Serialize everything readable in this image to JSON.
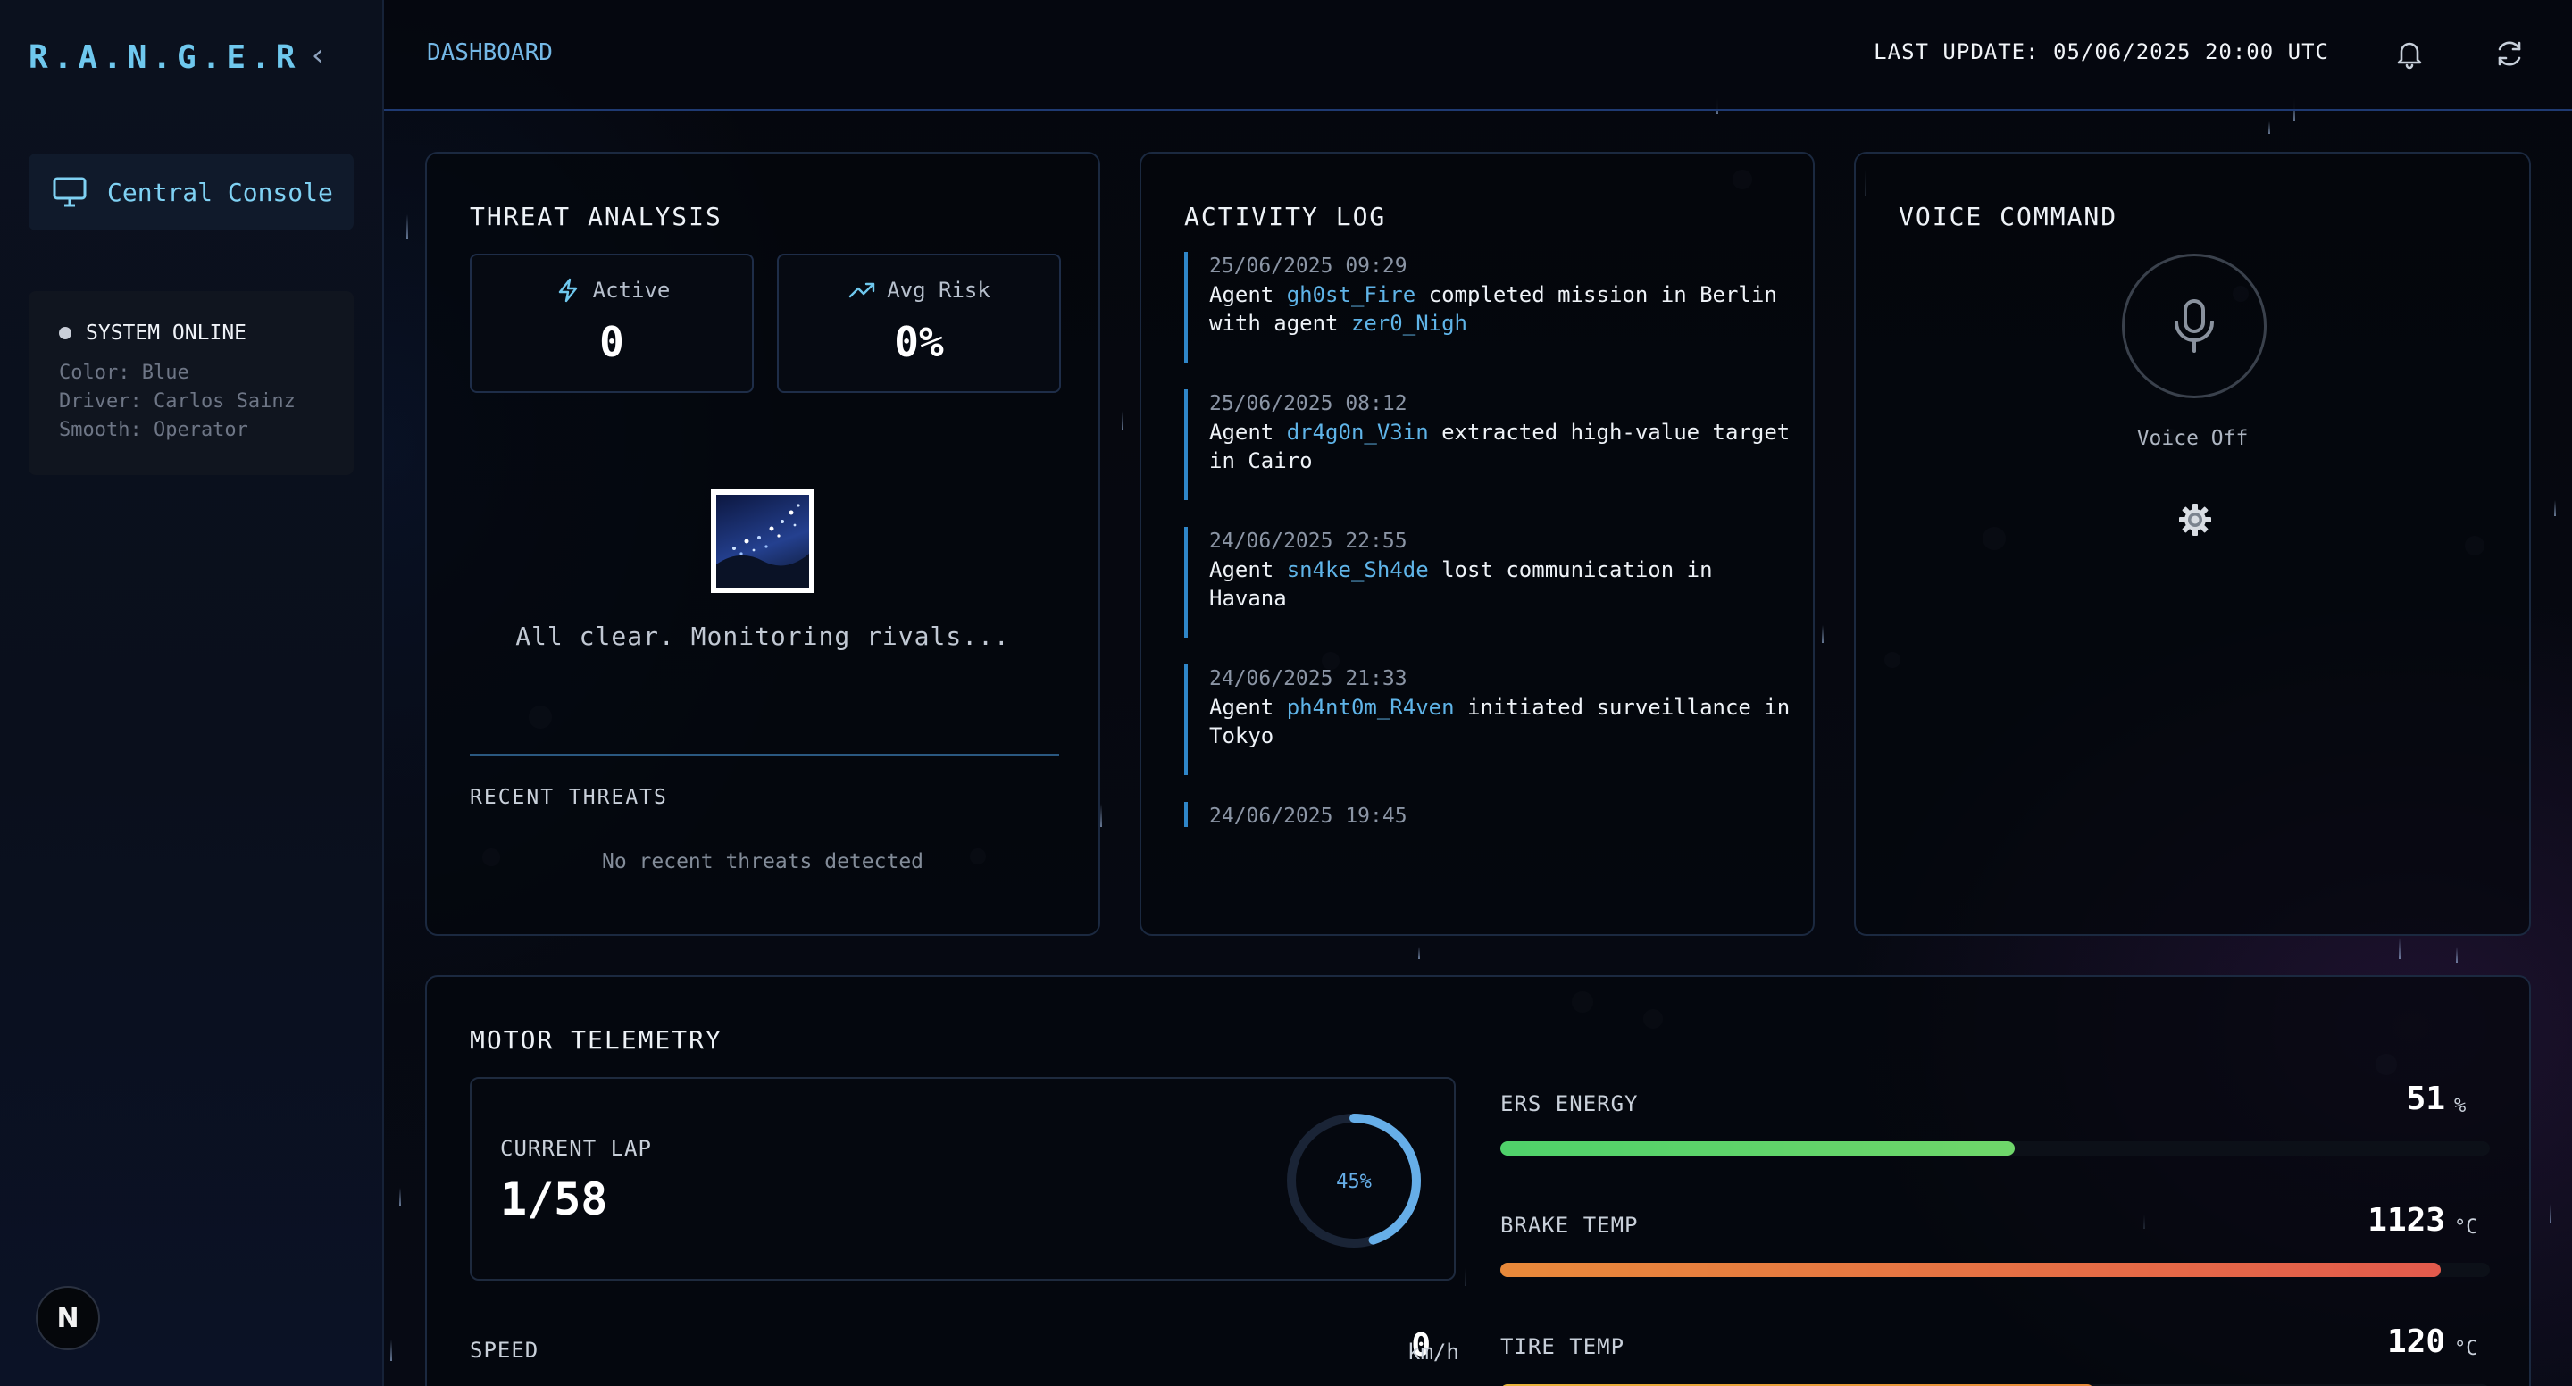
{
  "sidebar": {
    "brand": "R.A.N.G.E.R",
    "nav": [
      {
        "label": "Central Console",
        "icon": "monitor-icon"
      }
    ],
    "status": {
      "title": "SYSTEM ONLINE",
      "color": "Color: Blue",
      "driver": "Driver: Carlos Sainz",
      "smooth": "Smooth: Operator"
    },
    "badge": "N"
  },
  "header": {
    "breadcrumb": "DASHBOARD",
    "last_update": "LAST UPDATE: 05/06/2025 20:00 UTC"
  },
  "threat": {
    "title": "THREAT ANALYSIS",
    "active_label": "Active",
    "active_value": "0",
    "risk_label": "Avg Risk",
    "risk_value": "0%",
    "clear_text": "All clear. Monitoring rivals...",
    "recent_title": "RECENT THREATS",
    "recent_empty": "No recent threats detected"
  },
  "activity": {
    "title": "ACTIVITY LOG",
    "entries": [
      {
        "time": "25/06/2025 09:29",
        "pre": "Agent ",
        "agent": "gh0st_Fire",
        "mid": " completed mission in Berlin with agent ",
        "agent2": "zer0_Nigh",
        "post": ""
      },
      {
        "time": "25/06/2025 08:12",
        "pre": "Agent ",
        "agent": "dr4g0n_V3in",
        "mid": " extracted high-value target in Cairo",
        "agent2": "",
        "post": ""
      },
      {
        "time": "24/06/2025 22:55",
        "pre": "Agent ",
        "agent": "sn4ke_Sh4de",
        "mid": " lost communication in Havana",
        "agent2": "",
        "post": ""
      },
      {
        "time": "24/06/2025 21:33",
        "pre": "Agent ",
        "agent": "ph4nt0m_R4ven",
        "mid": " initiated surveillance in Tokyo",
        "agent2": "",
        "post": ""
      },
      {
        "time": "24/06/2025 19:45",
        "pre": "",
        "agent": "",
        "mid": "",
        "agent2": "",
        "post": ""
      }
    ]
  },
  "voice": {
    "title": "VOICE COMMAND",
    "status": "Voice Off"
  },
  "telemetry": {
    "title": "MOTOR TELEMETRY",
    "lap_label": "CURRENT LAP",
    "lap_value": "1/58",
    "progress_text": "45%",
    "progress": 0.45,
    "speed_label": "SPEED",
    "speed_value": "0",
    "speed_unit": "km/h",
    "metrics": [
      {
        "label": "ERS ENERGY",
        "value": "51",
        "unit": "%",
        "fill": 0.52,
        "color_from": "#4fd16a",
        "color_to": "#6fd66a"
      },
      {
        "label": "BRAKE TEMP",
        "value": "1123",
        "unit": "°C",
        "fill": 0.95,
        "color_from": "#e8893a",
        "color_to": "#e25a4c"
      },
      {
        "label": "TIRE TEMP",
        "value": "120",
        "unit": "°C",
        "fill": 0.6,
        "color_from": "#e8b43a",
        "color_to": "#e8893a"
      }
    ]
  },
  "colors": {
    "accent": "#6fc8ee",
    "agent": "#5fb4e8",
    "border": "#1b2940"
  }
}
